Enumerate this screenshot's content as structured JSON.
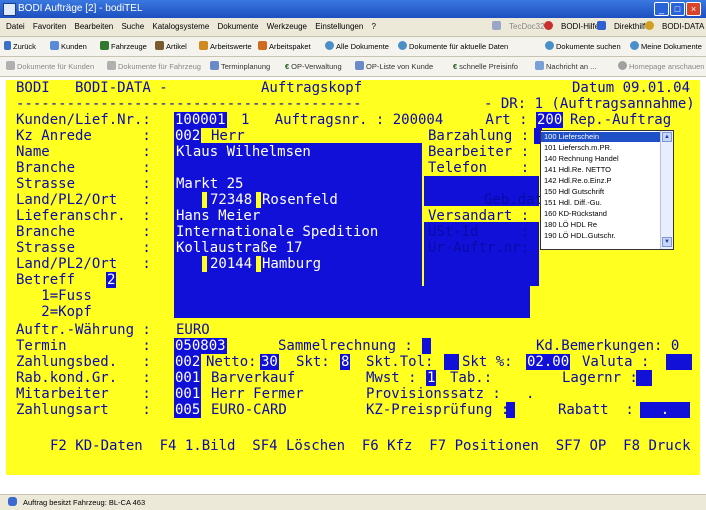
{
  "window": {
    "title": "BODI Aufträge [2] - bodiTEL"
  },
  "menubar": {
    "items": [
      "Datei",
      "Favoriten",
      "Bearbeiten",
      "Suche",
      "Katalogsysteme",
      "Dokumente",
      "Werkzeuge",
      "Einstellungen",
      "?"
    ],
    "right_items": [
      "TecDoc32",
      "BODI-Hilfe",
      "Direkthilfe",
      "BODI-DATA im Internet"
    ]
  },
  "toolbar1": {
    "items": [
      "Zurück",
      "Kunden",
      "Fahrzeuge",
      "Artikel",
      "Arbeitswerte",
      "Arbeitspaket",
      "Alle Dokumente",
      "Dokumente für aktuelle Daten",
      "Dokumente suchen",
      "Meine Dokumente"
    ]
  },
  "toolbar2": {
    "items": [
      "Dokumente für Kunden",
      "Dokumente für Fahrzeug",
      "Terminplanung",
      "OP-Verwaltung",
      "OP-Liste von Kunde",
      "schnelle Preisinfo",
      "Nachricht an ...",
      "Homepage anschauen"
    ]
  },
  "terminal": {
    "line1": {
      "left": "BODI   BODI-DATA -",
      "title": "Auftragskopf",
      "date": "Datum 09.01.04"
    },
    "line2": {
      "dashes": "-----------------------------------------",
      "dr": "- DR: 1 (Auftragsannahme)"
    },
    "line3": {
      "label": "Kunden/Lief.Nr.:",
      "kunde": "100001",
      "rest": "1   Auftragsnr. : 200004     Art :",
      "art": "200",
      "artname": "Rep.-Auftrag"
    },
    "line4": {
      "label": "Kz Anrede      :",
      "code": "002",
      "value": "Herr",
      "right_label": "Barzahlung :"
    },
    "line5": {
      "label": "Name           :",
      "value": "Klaus Wilhelmsen",
      "right_label": "Bearbeiter :"
    },
    "line6": {
      "label": "Branche        :",
      "right_label": "Telefon    :"
    },
    "line7": {
      "label": "Strasse        :",
      "value": "Markt 25"
    },
    "line8": {
      "label": "Land/PL2/Ort   :",
      "plz": "72348",
      "ort": "Rosenfeld",
      "right_label": "Geb.datum"
    },
    "line9": {
      "label": "Lieferanschr.  :",
      "value": "Hans Meier",
      "right_label": "Versandart :"
    },
    "line10": {
      "label": "Branche        :",
      "value": "Internationale Spedition",
      "right_label": "USt-Id     :"
    },
    "line11": {
      "label": "Strasse        :",
      "value": "Kollaustraße 17",
      "right_label": "Ur-Auftr.nr:"
    },
    "line12": {
      "label": "Land/PL2/Ort   :",
      "plz": "20144",
      "ort": "Hamburg"
    },
    "line13": {
      "label": "Betreff",
      "code": "2"
    },
    "line14": {
      "text": "   1=Fuss"
    },
    "line15": {
      "text": "   2=Kopf"
    },
    "line16": {
      "label": "Auftr.-Währung :",
      "value": "EURO"
    },
    "line17": {
      "label": "Termin         :",
      "value": "050803",
      "sammel": "Sammelrechnung :",
      "kd_bem": "Kd.Bemerkungen: 0"
    },
    "line18": {
      "label": "Zahlungsbed.   :",
      "code": "002",
      "netto_label": "Netto:",
      "netto": "30",
      "skt_label": "Skt:",
      "skt": "8",
      "skttol_label": "Skt.Tol:",
      "sktpct_label": "Skt %:",
      "sktpct": "02.00",
      "valuta_label": "Valuta :"
    },
    "line19": {
      "label": "Rab.kond.Gr.   :",
      "code": "001",
      "value": "Barverkauf",
      "mwst_label": "Mwst :",
      "mwst": "1",
      "tab_label": "Tab.:",
      "lager_label": "Lagernr :"
    },
    "line20": {
      "label": "Mitarbeiter    :",
      "code": "001",
      "value": "Herr Fermer",
      "prov_label": "Provisionssatz :",
      "prov": "."
    },
    "line21": {
      "label": "Zahlungsart    :",
      "code": "005",
      "value": "EURO-CARD",
      "kz_label": "KZ-Preisprüfung :",
      "rabatt_label": "Rabatt  :",
      "rabatt": "."
    },
    "fkeys": "F2 KD-Daten  F4 1.Bild  SF4 Löschen  F6 Kfz  F7 Positionen  SF7 OP  F8 Druck"
  },
  "art_dropdown": {
    "options": [
      "100 Lieferschein",
      "101 Liefersch.m.PR.",
      "140 Rechnung Handel",
      "141 Hdl.Re. NETTO",
      "142 Hdl.Re.o.Einz.P",
      "150 Hdl Gutschrift",
      "151 Hdl. Diff.-Gu.",
      "160 KD-Rückstand",
      "180 LÖ HDL Re",
      "190 LÖ HDL.Gutschr."
    ],
    "selected_index": 0
  },
  "statusbar": {
    "text": "Auftrag besitzt Fahrzeug: BL-CA 463"
  }
}
